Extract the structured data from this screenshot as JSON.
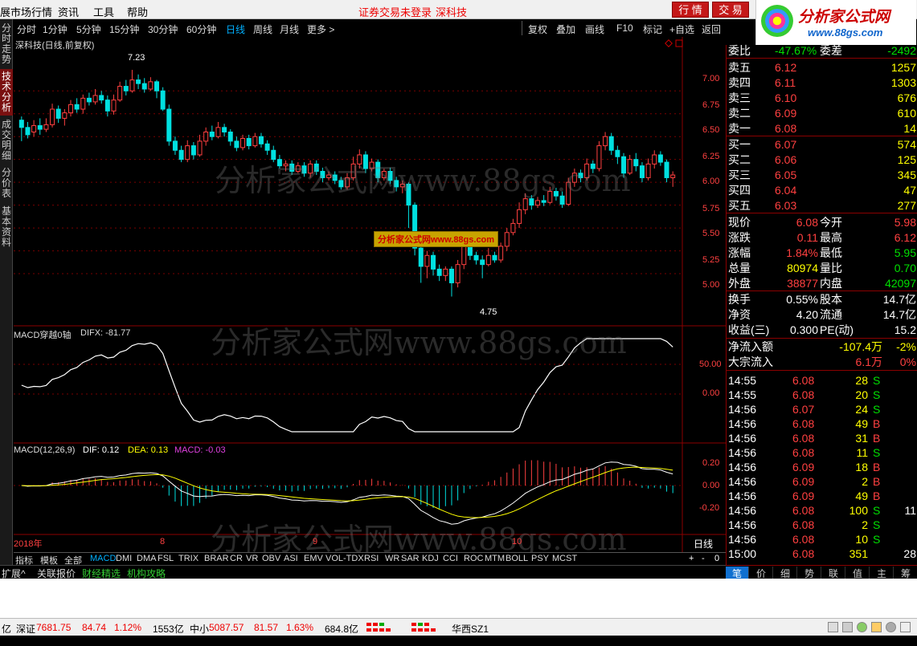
{
  "menubar": {
    "items": [
      "展市场行情",
      "资讯",
      "工具",
      "帮助"
    ],
    "login_text": "证券交易未登录",
    "stock_name": "深科技",
    "buttons": [
      "行 情",
      "交 易"
    ]
  },
  "logo": {
    "title": "分析家公式网",
    "url": "www.88gs.com"
  },
  "left_tabs": [
    "分时走势",
    "技术分析",
    "成交明细",
    "分价表",
    "基本资料"
  ],
  "period_bar": {
    "periods": [
      "分时",
      "1分钟",
      "5分钟",
      "15分钟",
      "30分钟",
      "60分钟",
      "日线",
      "周线",
      "月线",
      "更多 >"
    ],
    "active": "日线",
    "right_buttons": [
      "复权",
      "叠加",
      "画线",
      "F10",
      "标记",
      "+自选",
      "返回"
    ]
  },
  "main_chart": {
    "title": "深科技(日线,前复权)",
    "high_label": "7.23",
    "low_label": "4.75",
    "price_ticks": [
      "7.00",
      "6.75",
      "6.50",
      "6.25",
      "6.00",
      "5.75",
      "5.50",
      "5.25",
      "5.00"
    ]
  },
  "macd_axis_panel": {
    "title": "MACD穿越0轴",
    "value_label": "DIFX: -81.77",
    "ticks": [
      "50.00",
      "0.00"
    ]
  },
  "macd_panel": {
    "title": "MACD(12,26,9)",
    "dif": "DIF: 0.12",
    "dea": "DEA: 0.13",
    "macd": "MACD: -0.03",
    "ticks": [
      "0.20",
      "0.00",
      "-0.20"
    ]
  },
  "time_axis": {
    "labels": [
      "2018年",
      "8",
      "9",
      "10"
    ],
    "period_label": "日线"
  },
  "watermark": "分析家公式网www.88gs.com",
  "stamp": "分析家公式网www.88gs.com",
  "indicator_bar": {
    "items": [
      "指标",
      "模板",
      "全部",
      "MACD",
      "DMI",
      "DMA",
      "FSL",
      "TRIX",
      "BRAR",
      "CR",
      "VR",
      "OBV",
      "ASI",
      "EMV",
      "VOL-TDX",
      "RSI",
      "WR",
      "SAR",
      "KDJ",
      "CCI",
      "ROC",
      "MTM",
      "BOLL",
      "PSY",
      "MCST"
    ],
    "active": "MACD",
    "controls": [
      "+",
      "-",
      "0"
    ]
  },
  "sub_tabs": [
    "扩展^",
    "关联报价",
    "财经精选",
    "机构攻略"
  ],
  "quote": {
    "weibi": {
      "label": "委比",
      "value": "-47.67%",
      "label2": "委差",
      "value2": "-2492"
    },
    "asks": [
      {
        "label": "卖五",
        "price": "6.12",
        "vol": "1257"
      },
      {
        "label": "卖四",
        "price": "6.11",
        "vol": "1303"
      },
      {
        "label": "卖三",
        "price": "6.10",
        "vol": "676"
      },
      {
        "label": "卖二",
        "price": "6.09",
        "vol": "610"
      },
      {
        "label": "卖一",
        "price": "6.08",
        "vol": "14"
      }
    ],
    "bids": [
      {
        "label": "买一",
        "price": "6.07",
        "vol": "574"
      },
      {
        "label": "买二",
        "price": "6.06",
        "vol": "125"
      },
      {
        "label": "买三",
        "price": "6.05",
        "vol": "345"
      },
      {
        "label": "买四",
        "price": "6.04",
        "vol": "47"
      },
      {
        "label": "买五",
        "price": "6.03",
        "vol": "277"
      }
    ],
    "stats": [
      {
        "l1": "现价",
        "v1": "6.08",
        "l2": "今开",
        "v2": "5.98"
      },
      {
        "l1": "涨跌",
        "v1": "0.11",
        "l2": "最高",
        "v2": "6.12"
      },
      {
        "l1": "涨幅",
        "v1": "1.84%",
        "l2": "最低",
        "v2": "5.95"
      },
      {
        "l1": "总量",
        "v1": "80974",
        "l2": "量比",
        "v2": "0.70"
      },
      {
        "l1": "外盘",
        "v1": "38877",
        "l2": "内盘",
        "v2": "42097"
      }
    ],
    "fundamentals": [
      {
        "l1": "换手",
        "v1": "0.55%",
        "l2": "股本",
        "v2": "14.7亿"
      },
      {
        "l1": "净资",
        "v1": "4.20",
        "l2": "流通",
        "v2": "14.7亿"
      },
      {
        "l1": "收益(三)",
        "v1": "0.300",
        "l2": "PE(动)",
        "v2": "15.2"
      }
    ],
    "flow": [
      {
        "label": "净流入额",
        "value": "-107.4万",
        "pct": "-2%"
      },
      {
        "label": "大宗流入",
        "value": "6.1万",
        "pct": "0%"
      }
    ]
  },
  "ticks": [
    {
      "time": "14:55",
      "price": "6.08",
      "vol": "28",
      "dir": "S"
    },
    {
      "time": "14:55",
      "price": "6.08",
      "vol": "20",
      "dir": "S"
    },
    {
      "time": "14:56",
      "price": "6.07",
      "vol": "24",
      "dir": "S"
    },
    {
      "time": "14:56",
      "price": "6.08",
      "vol": "49",
      "dir": "B"
    },
    {
      "time": "14:56",
      "price": "6.08",
      "vol": "31",
      "dir": "B"
    },
    {
      "time": "14:56",
      "price": "6.08",
      "vol": "11",
      "dir": "S"
    },
    {
      "time": "14:56",
      "price": "6.09",
      "vol": "18",
      "dir": "B"
    },
    {
      "time": "14:56",
      "price": "6.09",
      "vol": "2",
      "dir": "B"
    },
    {
      "time": "14:56",
      "price": "6.09",
      "vol": "49",
      "dir": "B"
    },
    {
      "time": "14:56",
      "price": "6.08",
      "vol": "100",
      "dir": "S",
      "extra": "11"
    },
    {
      "time": "14:56",
      "price": "6.08",
      "vol": "2",
      "dir": "S"
    },
    {
      "time": "14:56",
      "price": "6.08",
      "vol": "10",
      "dir": "S"
    },
    {
      "time": "15:00",
      "price": "6.08",
      "vol": "351",
      "dir": "",
      "extra": "28"
    }
  ],
  "bottom_tabs": [
    "笔",
    "价",
    "细",
    "势",
    "联",
    "值",
    "主",
    "筹"
  ],
  "statusbar": {
    "prefix": "亿",
    "sz_label": "深证",
    "sz_value": "7681.75",
    "sz_change": "84.74",
    "sz_pct": "1.12%",
    "sz_amount": "1553亿",
    "zx_label": "中小",
    "zx_value": "5087.57",
    "zx_change": "81.57",
    "zx_pct": "1.63%",
    "zx_amount": "684.8亿",
    "server": "华西SZ1"
  },
  "colors": {
    "up": "#ff4040",
    "down": "#00e0e0",
    "grid": "#8b0000",
    "dif": "#ffffff",
    "dea": "#ffff00"
  },
  "chart_data": {
    "type": "candlestick",
    "price_range": [
      4.5,
      7.45
    ],
    "candles": [
      [
        6.68,
        6.6,
        6.72,
        6.45
      ],
      [
        6.6,
        6.52,
        6.66,
        6.48
      ],
      [
        6.55,
        6.62,
        6.68,
        6.5
      ],
      [
        6.62,
        6.58,
        6.7,
        6.52
      ],
      [
        6.58,
        6.63,
        6.7,
        6.55
      ],
      [
        6.63,
        6.8,
        6.86,
        6.6
      ],
      [
        6.8,
        6.7,
        6.84,
        6.65
      ],
      [
        6.7,
        6.76,
        6.8,
        6.62
      ],
      [
        6.76,
        6.85,
        6.9,
        6.72
      ],
      [
        6.85,
        6.8,
        6.92,
        6.76
      ],
      [
        6.8,
        6.92,
        6.96,
        6.75
      ],
      [
        6.92,
        6.88,
        6.98,
        6.84
      ],
      [
        6.88,
        6.95,
        7.02,
        6.85
      ],
      [
        6.95,
        6.9,
        7.0,
        6.86
      ],
      [
        6.9,
        6.78,
        6.95,
        6.72
      ],
      [
        6.78,
        6.9,
        6.96,
        6.74
      ],
      [
        6.9,
        7.05,
        7.1,
        6.88
      ],
      [
        7.05,
        7.0,
        7.12,
        6.95
      ],
      [
        7.0,
        7.12,
        7.23,
        6.98
      ],
      [
        7.12,
        7.08,
        7.18,
        7.02
      ],
      [
        7.08,
        7.02,
        7.14,
        6.98
      ],
      [
        7.02,
        7.1,
        7.15,
        7.0
      ],
      [
        7.1,
        7.0,
        7.12,
        6.92
      ],
      [
        7.0,
        6.8,
        7.04,
        6.78
      ],
      [
        6.8,
        6.45,
        6.85,
        6.4
      ],
      [
        6.45,
        6.35,
        6.5,
        6.3
      ],
      [
        6.35,
        6.25,
        6.4,
        6.22
      ],
      [
        6.25,
        6.4,
        6.46,
        6.22
      ],
      [
        6.4,
        6.3,
        6.44,
        6.25
      ],
      [
        6.3,
        6.45,
        6.52,
        6.28
      ],
      [
        6.45,
        6.55,
        6.6,
        6.4
      ],
      [
        6.55,
        6.5,
        6.62,
        6.46
      ],
      [
        6.5,
        6.6,
        6.66,
        6.48
      ],
      [
        6.6,
        6.55,
        6.64,
        6.5
      ],
      [
        6.55,
        6.45,
        6.58,
        6.4
      ],
      [
        6.45,
        6.38,
        6.5,
        6.34
      ],
      [
        6.38,
        6.48,
        6.52,
        6.35
      ],
      [
        6.48,
        6.4,
        6.52,
        6.36
      ],
      [
        6.4,
        6.5,
        6.54,
        6.38
      ],
      [
        6.5,
        6.42,
        6.54,
        6.38
      ],
      [
        6.42,
        6.35,
        6.46,
        6.3
      ],
      [
        6.35,
        6.25,
        6.4,
        6.22
      ],
      [
        6.25,
        6.18,
        6.3,
        6.15
      ],
      [
        6.18,
        6.2,
        6.24,
        6.12
      ],
      [
        6.2,
        6.12,
        6.24,
        6.08
      ],
      [
        6.12,
        6.18,
        6.22,
        6.1
      ],
      [
        6.18,
        6.1,
        6.22,
        6.06
      ],
      [
        6.1,
        6.2,
        6.24,
        6.05
      ],
      [
        6.2,
        6.12,
        6.24,
        6.08
      ],
      [
        6.12,
        6.05,
        6.16,
        6.0
      ],
      [
        6.05,
        6.08,
        6.12,
        6.02
      ],
      [
        6.08,
        6.02,
        6.12,
        5.98
      ],
      [
        6.02,
        5.95,
        6.06,
        5.92
      ],
      [
        5.95,
        6.05,
        6.1,
        5.92
      ],
      [
        6.05,
        6.2,
        6.28,
        6.02
      ],
      [
        6.2,
        6.3,
        6.36,
        6.15
      ],
      [
        6.3,
        6.15,
        6.34,
        6.1
      ],
      [
        6.15,
        6.22,
        6.26,
        6.12
      ],
      [
        6.22,
        6.05,
        6.25,
        6.0
      ],
      [
        6.05,
        6.12,
        6.15,
        6.02
      ],
      [
        6.12,
        6.02,
        6.16,
        5.98
      ],
      [
        6.02,
        5.95,
        6.06,
        5.9
      ],
      [
        5.95,
        5.98,
        6.02,
        5.88
      ],
      [
        5.98,
        5.75,
        6.0,
        5.5
      ],
      [
        5.75,
        5.28,
        5.78,
        5.2
      ],
      [
        5.28,
        5.08,
        5.32,
        4.9
      ],
      [
        5.08,
        5.2,
        5.25,
        4.95
      ],
      [
        5.2,
        5.05,
        5.24,
        4.98
      ],
      [
        5.05,
        4.98,
        5.1,
        4.92
      ],
      [
        4.98,
        5.05,
        5.08,
        4.92
      ],
      [
        5.05,
        4.9,
        5.08,
        4.75
      ],
      [
        4.9,
        5.1,
        5.15,
        4.85
      ],
      [
        5.1,
        5.3,
        5.35,
        5.05
      ],
      [
        5.3,
        5.2,
        5.34,
        5.15
      ],
      [
        5.2,
        5.15,
        5.24,
        5.1
      ],
      [
        5.15,
        5.1,
        5.2,
        4.95
      ],
      [
        5.1,
        5.2,
        5.28,
        5.08
      ],
      [
        5.2,
        5.15,
        5.24,
        5.12
      ],
      [
        5.15,
        5.3,
        5.34,
        5.12
      ],
      [
        5.3,
        5.45,
        5.5,
        5.25
      ],
      [
        5.45,
        5.55,
        5.6,
        5.42
      ],
      [
        5.55,
        5.7,
        5.78,
        5.5
      ],
      [
        5.7,
        5.82,
        5.88,
        5.65
      ],
      [
        5.82,
        5.75,
        5.86,
        5.7
      ],
      [
        5.75,
        5.8,
        5.84,
        5.72
      ],
      [
        5.8,
        5.78,
        5.86,
        5.74
      ],
      [
        5.78,
        5.9,
        5.95,
        5.76
      ],
      [
        5.9,
        5.85,
        5.94,
        5.8
      ],
      [
        5.85,
        5.76,
        5.9,
        5.72
      ],
      [
        5.76,
        6.0,
        6.05,
        5.74
      ],
      [
        6.0,
        6.1,
        6.15,
        5.95
      ],
      [
        6.1,
        6.05,
        6.14,
        6.0
      ],
      [
        6.05,
        6.2,
        6.26,
        6.02
      ],
      [
        6.2,
        6.15,
        6.24,
        6.1
      ],
      [
        6.15,
        6.4,
        6.45,
        6.12
      ],
      [
        6.4,
        6.5,
        6.55,
        6.35
      ],
      [
        6.5,
        6.35,
        6.54,
        6.3
      ],
      [
        6.35,
        6.28,
        6.4,
        6.2
      ],
      [
        6.28,
        6.1,
        6.32,
        6.05
      ],
      [
        6.1,
        6.25,
        6.3,
        6.08
      ],
      [
        6.25,
        6.18,
        6.32,
        6.12
      ],
      [
        6.18,
        6.05,
        6.22,
        6.0
      ],
      [
        6.05,
        6.2,
        6.26,
        6.02
      ],
      [
        6.2,
        6.3,
        6.35,
        6.15
      ],
      [
        6.3,
        6.22,
        6.34,
        6.18
      ],
      [
        6.22,
        6.05,
        6.25,
        6.0
      ],
      [
        6.05,
        6.08,
        6.12,
        5.95
      ]
    ]
  }
}
